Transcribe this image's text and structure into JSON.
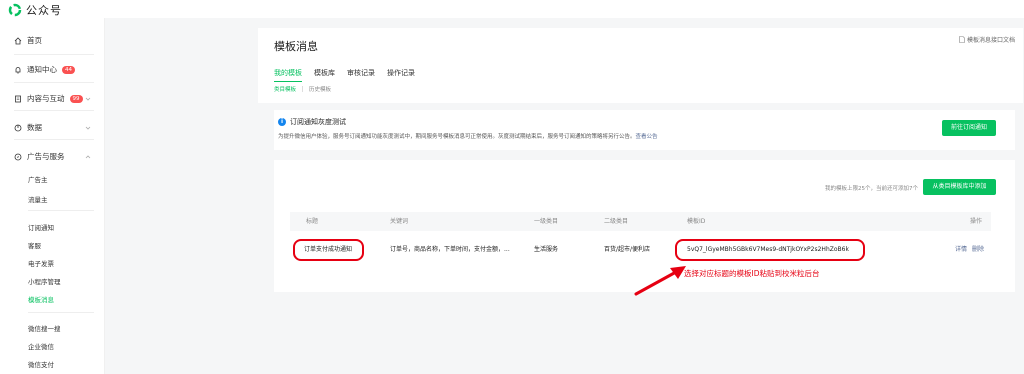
{
  "brand": {
    "name": "公众号",
    "accent": "#07c160"
  },
  "sidebar": {
    "home": "首页",
    "notifications": {
      "label": "通知中心",
      "badge": "44"
    },
    "content": {
      "label": "内容与互动",
      "badge": "99"
    },
    "data": "数据",
    "ads": "广告与服务",
    "ads_items": [
      "广告主",
      "流量主"
    ],
    "service_items": [
      "订阅通知",
      "客服",
      "电子发票",
      "小程序管理",
      "模板消息"
    ],
    "other_items": [
      "微信搜一搜",
      "企业微信",
      "微信支付"
    ]
  },
  "page": {
    "title": "模板消息",
    "doc_link": "模板消息接口文档",
    "tabs": [
      "我的模板",
      "模板库",
      "审核记录",
      "操作记录"
    ],
    "subtabs": [
      "类目模板",
      "历史模板"
    ]
  },
  "notice": {
    "title": "订阅通知灰度测试",
    "desc": "为提升微信用户体验，服务号订阅通知功能灰度测试中，期间服务号模板消息可正常使用。灰度测试期结束后，服务号订阅通知的策略将另行公告。",
    "link": "查看公告",
    "button": "前往订阅通知"
  },
  "templates": {
    "quota": "我的模板上限25个，当前还可添加7个",
    "add_button": "从类目模板库中添加",
    "columns": [
      "标题",
      "关键词",
      "一级类目",
      "二级类目",
      "模板ID",
      "操作"
    ],
    "rows": [
      {
        "title": "订单支付成功通知",
        "keywords": "订单号，商品名称，下单时间，支付金额，...",
        "cat1": "生活服务",
        "cat2": "百货/超市/便利店",
        "template_id": "5vQ7_lGyeMBh5GBk6V7Mes9-dNTjkOYxP2s2HhZoB6k",
        "actions": [
          "详情",
          "删除"
        ]
      }
    ]
  },
  "annotation": {
    "text": "选择对应标题的模板ID粘贴到校米粒后台",
    "color": "#e60012"
  }
}
